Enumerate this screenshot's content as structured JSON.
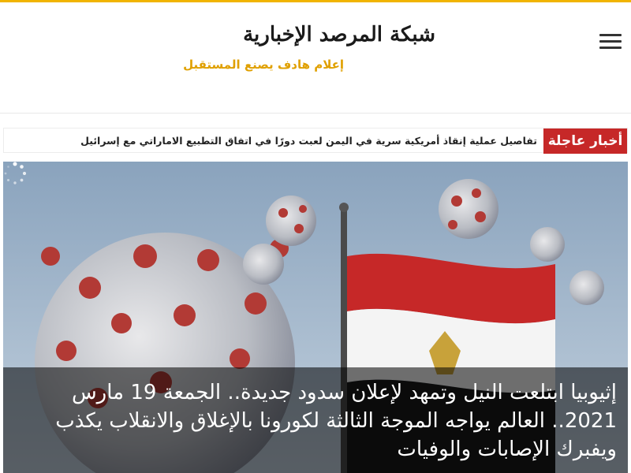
{
  "site": {
    "title": "شبكة المرصد الإخبارية",
    "slogan": "إعلام هادف يصنع المستقبل"
  },
  "breaking_news": {
    "label": "أخبار عاجلة",
    "headline": "تفاصيل عملية إنقاذ أمريكية سرية في اليمن لعبت دورًا في اتفاق التطبيع الاماراتي مع إسرائيل"
  },
  "featured": {
    "headline": "إثيوبيا ابتلعت النيل وتمهد لإعلان سدود جديدة.. الجمعة 19 مارس 2021.. العالم يواجه الموجة الثالثة لكورونا بالإغلاق والانقلاب يكذب ويفبرك الإصابات والوفيات"
  },
  "colors": {
    "accent": "#f1b400",
    "breaking": "#c62828",
    "slogan": "#e0a000"
  },
  "icons": {
    "menu": "hamburger-icon",
    "loading": "spinner-icon"
  }
}
